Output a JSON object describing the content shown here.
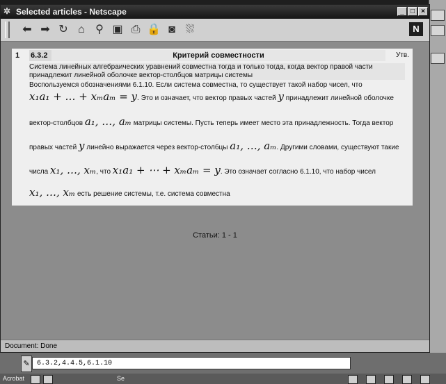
{
  "window": {
    "title": "Selected articles - Netscape",
    "min": "_",
    "max": "□",
    "close": "×"
  },
  "toolbar": {
    "icons": [
      "back-icon",
      "forward-icon",
      "reload-icon",
      "home-icon",
      "search-icon",
      "netscape-guide-icon",
      "print-icon",
      "security-icon",
      "images-icon",
      "stop-icon"
    ],
    "brand": "N"
  },
  "article": {
    "num": "1",
    "section": "6.3.2",
    "heading": "Критерий совместности",
    "kind": "Утв.",
    "statement": "Система линейных алгебраических уравнений совместна тогда и только тогда, когда вектор правой части принадлежит линейной оболочке вектор-столбцов матрицы системы",
    "p1": "Воспользуемся обозначениями 6.1.10. Если система совместна, то существует такой набор чисел, что",
    "f1": "x₁a₁ + … + xₘaₘ = y",
    "t1": ". Это и означает, что вектор правых частей",
    "f2": "y",
    "t2": "принадлежит линейной оболочке",
    "t3": "вектор-столбцов",
    "f3": "a₁, …, aₘ",
    "t4": "матрицы системы. Пусть теперь имеет место эта принадлежность. Тогда вектор",
    "t5": "правых частей",
    "f4": "y",
    "t6": "линейно выражается через вектор-столбцы",
    "f5": "a₁, …, aₘ",
    "t7": ". Другими словами, существуют такие",
    "t8": "числа",
    "f6": "x₁, …, xₘ",
    "t9": ", что",
    "f7": "x₁a₁ + ⋯ + xₘaₘ = y",
    "t10": ". Это означает согласно 6.1.10, что набор чисел",
    "f8": "x₁, …, xₘ",
    "t11": "есть решение системы, т.е. система совместна"
  },
  "count_label": "Статьи: 1 - 1",
  "status": "Document: Done",
  "input_value": "6.3.2,4.4.5,6.1.10",
  "taskbar": {
    "app1": "Acrobat",
    "app2": "Se"
  }
}
